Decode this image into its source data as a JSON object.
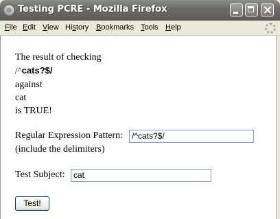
{
  "window": {
    "title": "Testing PCRE - Mozilla Firefox"
  },
  "menu": {
    "items": [
      {
        "first": "F",
        "rest": "ile"
      },
      {
        "first": "E",
        "rest": "dit"
      },
      {
        "first": "V",
        "rest": "iew"
      },
      {
        "first": "Hi",
        "ul": "s",
        "tail": "tory"
      },
      {
        "first": "B",
        "rest": "ookmarks"
      },
      {
        "first": "T",
        "rest": "ools"
      },
      {
        "first": "H",
        "rest": "elp"
      }
    ]
  },
  "result": {
    "line1": "The result of checking",
    "pattern_caret": "/^",
    "pattern_rest": "cats?$/",
    "line3": "against",
    "subject": "cat",
    "line5": "is TRUE!"
  },
  "form": {
    "pattern_label": "Regular Expression Pattern:",
    "pattern_value": "/^cats?$/",
    "pattern_hint": "(include the delimiters)",
    "subject_label": "Test Subject:",
    "subject_value": "cat",
    "submit_label": "Test!"
  }
}
